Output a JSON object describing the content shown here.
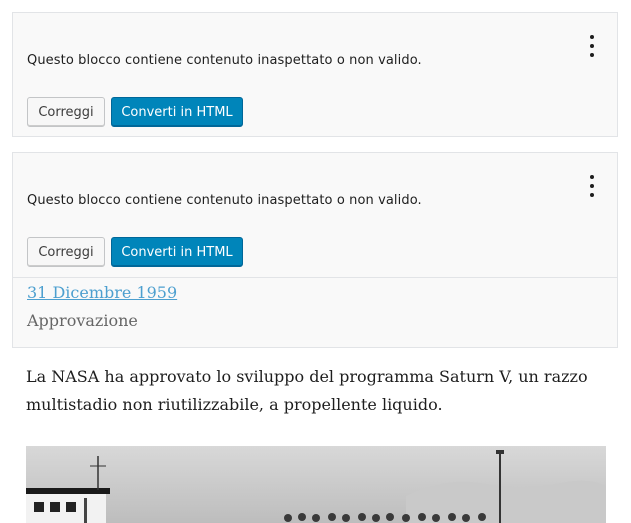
{
  "warning_blocks": [
    {
      "message": "Questo blocco contiene contenuto inaspettato o non valido.",
      "resolve_label": "Correggi",
      "convert_label": "Converti in HTML"
    },
    {
      "message": "Questo blocco contiene contenuto inaspettato o non valido.",
      "resolve_label": "Correggi",
      "convert_label": "Converti in HTML"
    }
  ],
  "timeline_entry": {
    "date": "31 Dicembre 1959",
    "label": "Approvazione"
  },
  "paragraph": "La NASA ha approvato lo sviluppo del programma Saturn V, un razzo multistadio non riutilizzabile, a propellente liquido.",
  "icons": {
    "block_menu": "more-vertical-icon"
  }
}
